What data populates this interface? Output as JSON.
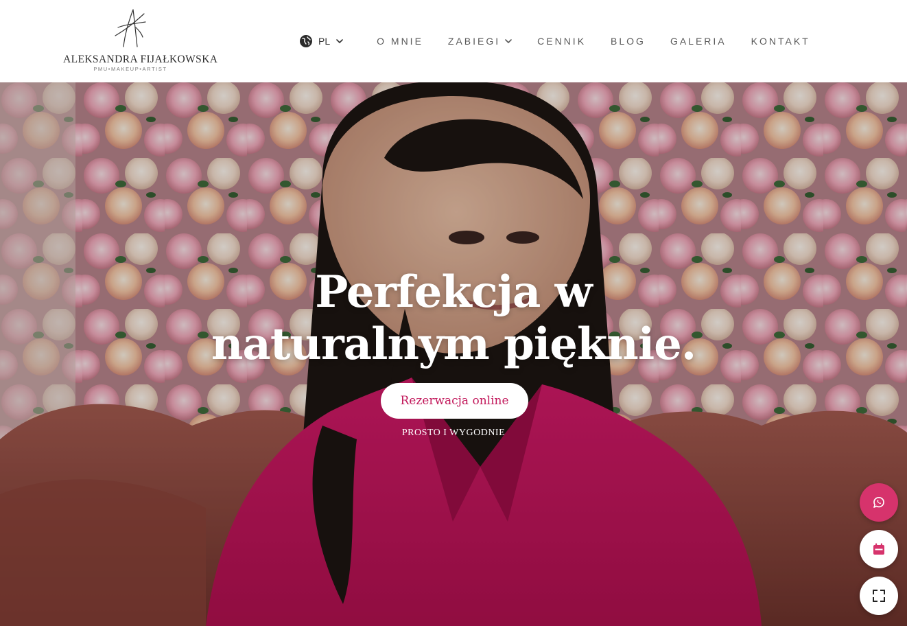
{
  "header": {
    "logo": {
      "name": "ALEKSANDRA FIJAŁKOWSKA",
      "tagline": "PMU•MAKEUP•ARTIST"
    },
    "language": {
      "label": "PL",
      "icon": "globe-icon"
    },
    "nav": [
      {
        "label": "O MNIE"
      },
      {
        "label": "ZABIEGI",
        "has_dropdown": true
      },
      {
        "label": "CENNIK"
      },
      {
        "label": "BLOG"
      },
      {
        "label": "GALERIA"
      },
      {
        "label": "KONTAKT"
      }
    ]
  },
  "hero": {
    "title_line1": "Perfekcja w",
    "title_line2": "naturalnym pięknie.",
    "cta_label": "Rezerwacja online",
    "cta_sub": "PROSTO I WYGODNIE"
  },
  "floating_buttons": [
    {
      "icon": "whatsapp-icon",
      "color": "#d6336c"
    },
    {
      "icon": "calendar-icon",
      "color": "#ffffff"
    },
    {
      "icon": "expand-icon",
      "color": "#ffffff"
    }
  ],
  "colors": {
    "accent": "#c2185b",
    "whatsapp_button": "#d6336c",
    "jacket": "#c4145e"
  }
}
